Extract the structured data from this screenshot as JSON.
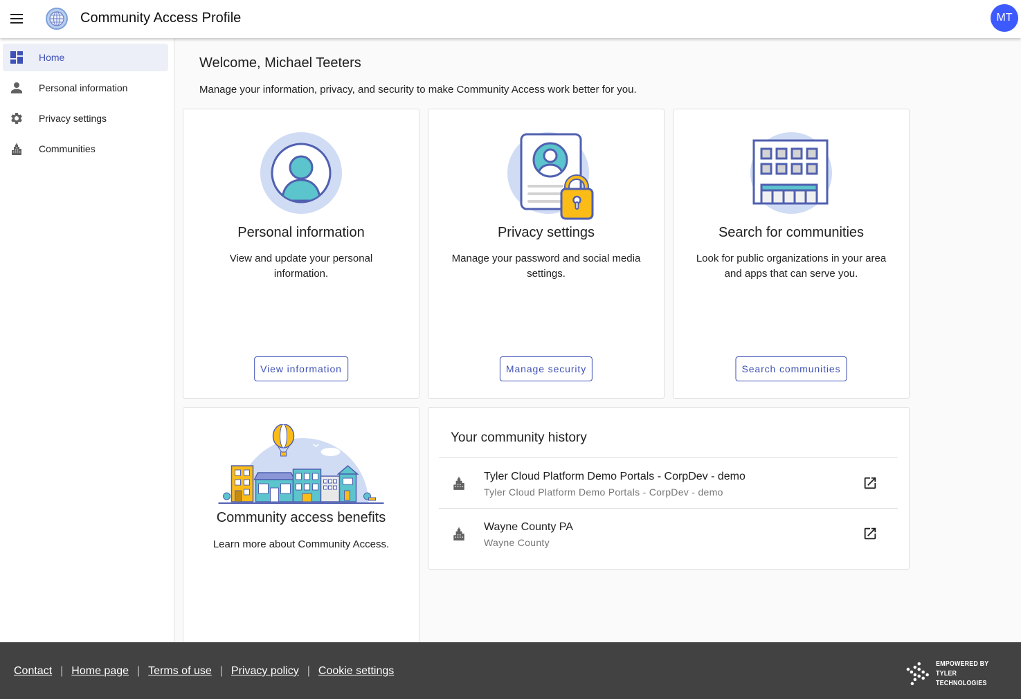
{
  "header": {
    "app_title": "Community Access Profile",
    "avatar_initials": "MT",
    "avatar_color": "#3d5afe"
  },
  "sidebar": {
    "items": [
      {
        "label": "Home",
        "icon": "dashboard-icon",
        "active": true
      },
      {
        "label": "Personal information",
        "icon": "person-icon",
        "active": false
      },
      {
        "label": "Privacy settings",
        "icon": "gear-icon",
        "active": false
      },
      {
        "label": "Communities",
        "icon": "city-building-icon",
        "active": false
      }
    ]
  },
  "main": {
    "welcome": "Welcome, Michael Teeters",
    "subtitle": "Manage your information, privacy, and security to make Community Access work better for you.",
    "cards": [
      {
        "title": "Personal information",
        "description": "View and update your personal information.",
        "button": "View information",
        "icon": "profile-avatar-icon"
      },
      {
        "title": "Privacy settings",
        "description": "Manage your password and social media settings.",
        "button": "Manage security",
        "icon": "document-lock-icon"
      },
      {
        "title": "Search for communities",
        "description": "Look for public organizations in your area and apps that can serve you.",
        "button": "Search communities",
        "icon": "office-building-icon"
      },
      {
        "title": "Community access benefits",
        "description": "Learn more about Community Access.",
        "icon": "town-illustration"
      }
    ],
    "history": {
      "title": "Your community history",
      "items": [
        {
          "primary": "Tyler Cloud Platform Demo Portals - CorpDev - demo",
          "secondary": "Tyler Cloud Platform Demo Portals - CorpDev - demo"
        },
        {
          "primary": "Wayne County PA",
          "secondary": "Wayne County"
        }
      ]
    }
  },
  "footer": {
    "links": [
      "Contact",
      "Home page",
      "Terms of use",
      "Privacy policy",
      "Cookie settings"
    ],
    "separator": "|",
    "brand_line1": "EMPOWERED BY",
    "brand_line2": "TYLER TECHNOLOGIES"
  },
  "colors": {
    "accent": "#3f51b5",
    "illustration_light": "#d0dcf4",
    "illustration_stroke": "#5060b0",
    "teal": "#5bc4cc",
    "lock_yellow": "#fbbc17"
  }
}
